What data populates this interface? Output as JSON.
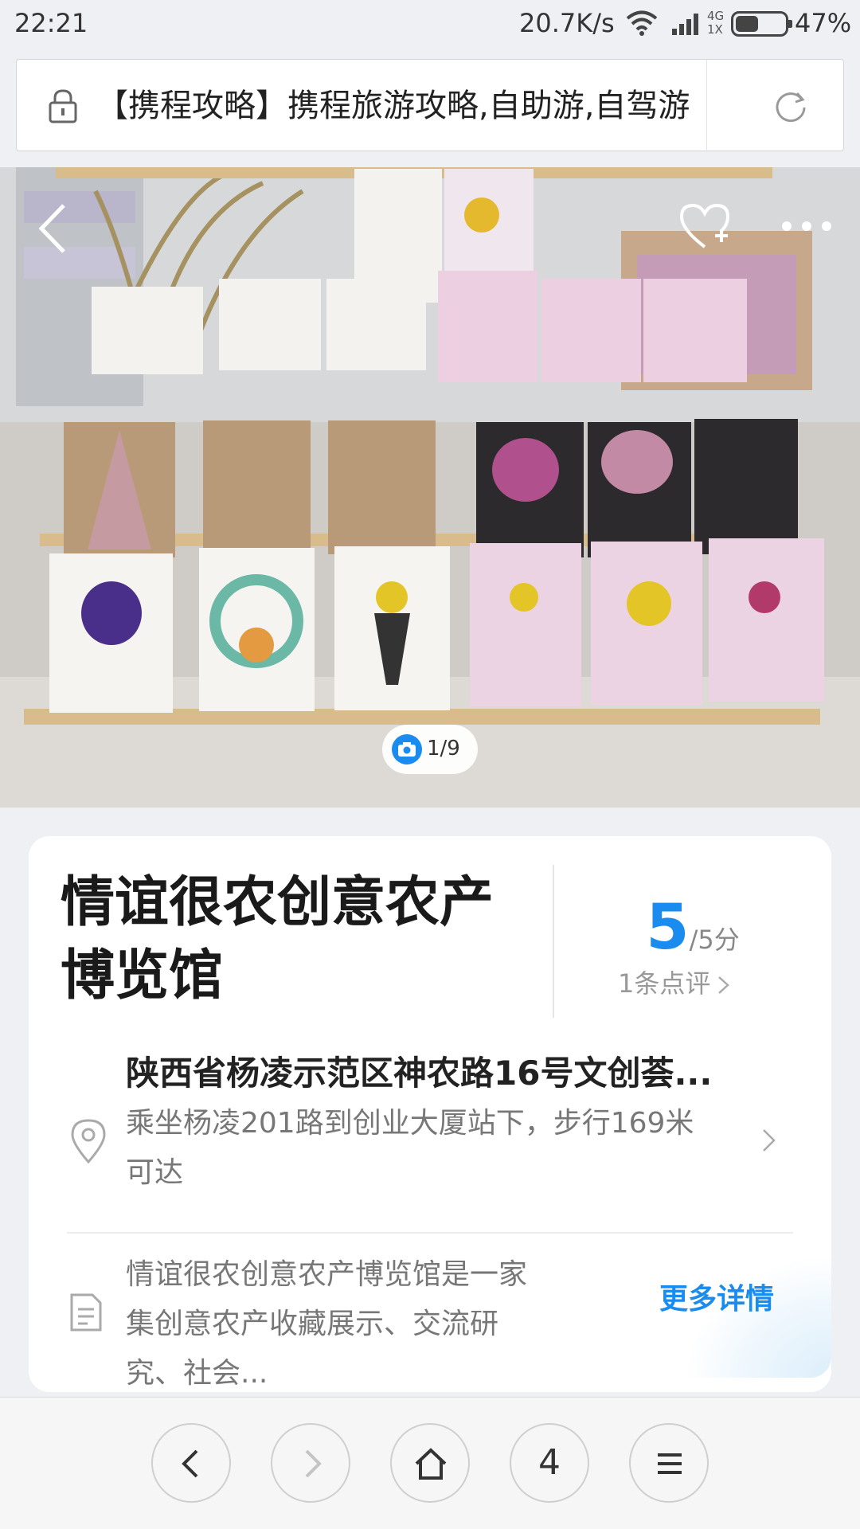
{
  "status_bar": {
    "time": "22:21",
    "net_speed": "20.7K/s",
    "network_type_top": "4G",
    "network_type_bottom": "1X",
    "battery_percent": "47%",
    "battery_level": 0.47
  },
  "address_bar": {
    "url_text": "【携程攻略】携程旅游攻略,自助游,自驾游"
  },
  "hero": {
    "photo_counter": "1/9"
  },
  "poi": {
    "title": "情谊很农创意农产博览馆",
    "rating_score": "5",
    "rating_max": "/5分",
    "reviews_link": "1条点评",
    "address": "陕西省杨凌示范区神农路16号文创荟...",
    "transit": "乘坐杨凌201路到创业大厦站下，步行169米可达",
    "intro": "情谊很农创意农产博览馆是一家集创意农产收藏展示、交流研究、社会...",
    "more_details": "更多详情"
  },
  "bottom_nav": {
    "tabs_count": "4"
  },
  "colors": {
    "accent": "#1a8cf0",
    "background": "#eef0f3"
  }
}
